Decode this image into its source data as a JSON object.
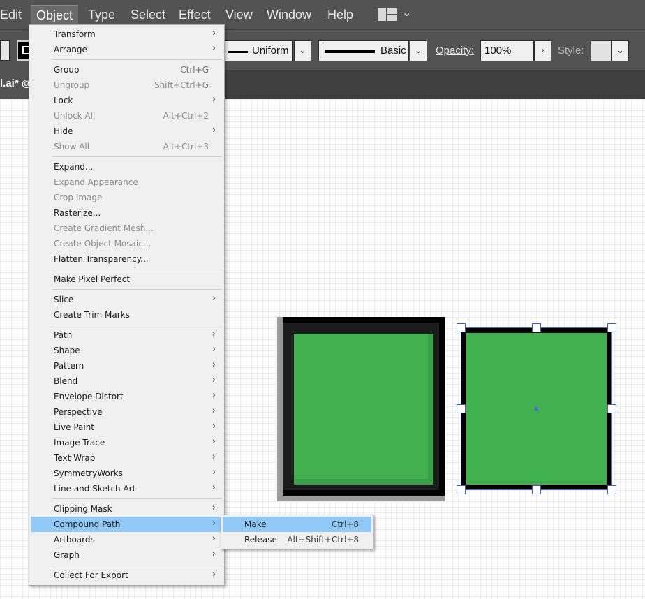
{
  "menubar": {
    "items": [
      "Edit",
      "Object",
      "Type",
      "Select",
      "Effect",
      "View",
      "Window",
      "Help"
    ],
    "active": "Object",
    "workspace_icon": "workspace-switcher-icon"
  },
  "controlbar": {
    "profile_label": "Uniform",
    "brush_label": "Basic",
    "opacity_label": "Opacity:",
    "opacity_value": "100%",
    "style_label": "Style:"
  },
  "document": {
    "tab_label": "l.ai* @"
  },
  "object_menu": {
    "items": [
      {
        "label": "Transform",
        "shortcut": "",
        "submenu": true,
        "disabled": false
      },
      {
        "label": "Arrange",
        "shortcut": "",
        "submenu": true,
        "disabled": false
      },
      {
        "label": "Group",
        "shortcut": "Ctrl+G",
        "submenu": false,
        "disabled": false
      },
      {
        "label": "Ungroup",
        "shortcut": "Shift+Ctrl+G",
        "submenu": false,
        "disabled": true
      },
      {
        "label": "Lock",
        "shortcut": "",
        "submenu": true,
        "disabled": false
      },
      {
        "label": "Unlock All",
        "shortcut": "Alt+Ctrl+2",
        "submenu": false,
        "disabled": true
      },
      {
        "label": "Hide",
        "shortcut": "",
        "submenu": true,
        "disabled": false
      },
      {
        "label": "Show All",
        "shortcut": "Alt+Ctrl+3",
        "submenu": false,
        "disabled": true
      },
      {
        "label": "Expand...",
        "shortcut": "",
        "submenu": false,
        "disabled": false
      },
      {
        "label": "Expand Appearance",
        "shortcut": "",
        "submenu": false,
        "disabled": true
      },
      {
        "label": "Crop Image",
        "shortcut": "",
        "submenu": false,
        "disabled": true
      },
      {
        "label": "Rasterize...",
        "shortcut": "",
        "submenu": false,
        "disabled": false
      },
      {
        "label": "Create Gradient Mesh...",
        "shortcut": "",
        "submenu": false,
        "disabled": true
      },
      {
        "label": "Create Object Mosaic...",
        "shortcut": "",
        "submenu": false,
        "disabled": true
      },
      {
        "label": "Flatten Transparency...",
        "shortcut": "",
        "submenu": false,
        "disabled": false
      },
      {
        "label": "Make Pixel Perfect",
        "shortcut": "",
        "submenu": false,
        "disabled": false
      },
      {
        "label": "Slice",
        "shortcut": "",
        "submenu": true,
        "disabled": false
      },
      {
        "label": "Create Trim Marks",
        "shortcut": "",
        "submenu": false,
        "disabled": false
      },
      {
        "label": "Path",
        "shortcut": "",
        "submenu": true,
        "disabled": false
      },
      {
        "label": "Shape",
        "shortcut": "",
        "submenu": true,
        "disabled": false
      },
      {
        "label": "Pattern",
        "shortcut": "",
        "submenu": true,
        "disabled": false
      },
      {
        "label": "Blend",
        "shortcut": "",
        "submenu": true,
        "disabled": false
      },
      {
        "label": "Envelope Distort",
        "shortcut": "",
        "submenu": true,
        "disabled": false
      },
      {
        "label": "Perspective",
        "shortcut": "",
        "submenu": true,
        "disabled": false
      },
      {
        "label": "Live Paint",
        "shortcut": "",
        "submenu": true,
        "disabled": false
      },
      {
        "label": "Image Trace",
        "shortcut": "",
        "submenu": true,
        "disabled": false
      },
      {
        "label": "Text Wrap",
        "shortcut": "",
        "submenu": true,
        "disabled": false
      },
      {
        "label": "SymmetryWorks",
        "shortcut": "",
        "submenu": true,
        "disabled": false
      },
      {
        "label": "Line and Sketch Art",
        "shortcut": "",
        "submenu": true,
        "disabled": false
      },
      {
        "label": "Clipping Mask",
        "shortcut": "",
        "submenu": true,
        "disabled": false
      },
      {
        "label": "Compound Path",
        "shortcut": "",
        "submenu": true,
        "disabled": false,
        "highlighted": true
      },
      {
        "label": "Artboards",
        "shortcut": "",
        "submenu": true,
        "disabled": false
      },
      {
        "label": "Graph",
        "shortcut": "",
        "submenu": true,
        "disabled": false
      },
      {
        "label": "Collect For Export",
        "shortcut": "",
        "submenu": true,
        "disabled": false
      }
    ]
  },
  "compound_submenu": {
    "items": [
      {
        "label": "Make",
        "shortcut": "Ctrl+8",
        "highlighted": true
      },
      {
        "label": "Release",
        "shortcut": "Alt+Shift+Ctrl+8",
        "highlighted": false
      }
    ]
  },
  "colors": {
    "menu_highlight": "#91c9f7",
    "artwork_green": "#41b14f",
    "selection_blue": "#4a6be0"
  }
}
